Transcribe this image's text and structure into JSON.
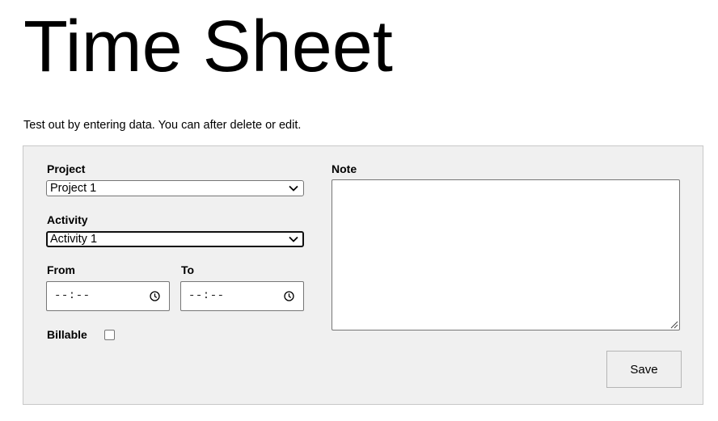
{
  "page": {
    "title": "Time Sheet",
    "intro": "Test out by entering data. You can after delete or edit."
  },
  "form": {
    "project": {
      "label": "Project",
      "value": "Project 1"
    },
    "activity": {
      "label": "Activity",
      "value": "Activity 1"
    },
    "from": {
      "label": "From",
      "value": "--:--"
    },
    "to": {
      "label": "To",
      "value": "--:--"
    },
    "billable": {
      "label": "Billable",
      "checked": false
    },
    "note": {
      "label": "Note",
      "value": ""
    },
    "save_label": "Save"
  },
  "icons": {
    "select_arrow": "chevron-down-icon",
    "time_picker": "clock-icon",
    "resize": "resize-grip-icon"
  }
}
